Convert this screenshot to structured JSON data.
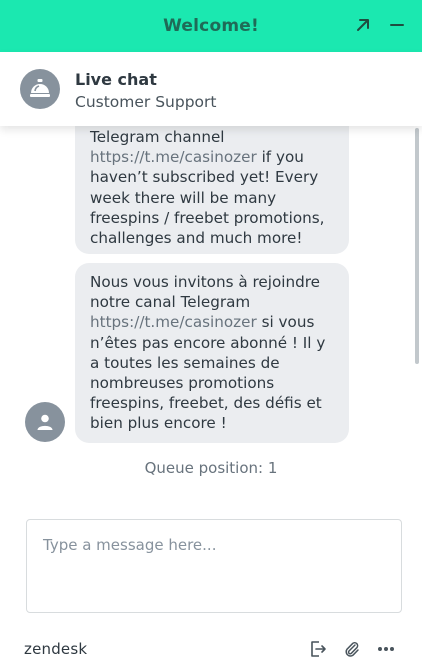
{
  "header": {
    "title": "Welcome!",
    "background": "#1be8b0",
    "popout_icon": "arrow-up-right-icon",
    "minimize_icon": "minus-icon"
  },
  "agent": {
    "name": "Live chat",
    "department": "Customer Support",
    "avatar_icon": "service-bell-icon"
  },
  "messages": [
    {
      "text_before": "Telegram channel",
      "link": "https://t.me/casinozer",
      "text_after": " if you haven’t subscribed yet! Every week there will be many freespins / freebet promotions, challenges and much more!"
    },
    {
      "text_before": "Nous vous invitons à rejoindre notre canal Telegram",
      "link": "https://t.me/casinozer",
      "text_after": " si vous n’êtes pas encore abonné ! Il y a toutes les semaines de nombreuses promotions freespins, freebet, des défis et bien plus encore !"
    }
  ],
  "sender_avatar_icon": "user-icon",
  "queue_status": "Queue position: 1",
  "composer": {
    "placeholder": "Type a message here..."
  },
  "footer": {
    "brand": "zendesk",
    "icons": [
      "end-chat-icon",
      "attachment-icon",
      "more-options-icon"
    ]
  }
}
